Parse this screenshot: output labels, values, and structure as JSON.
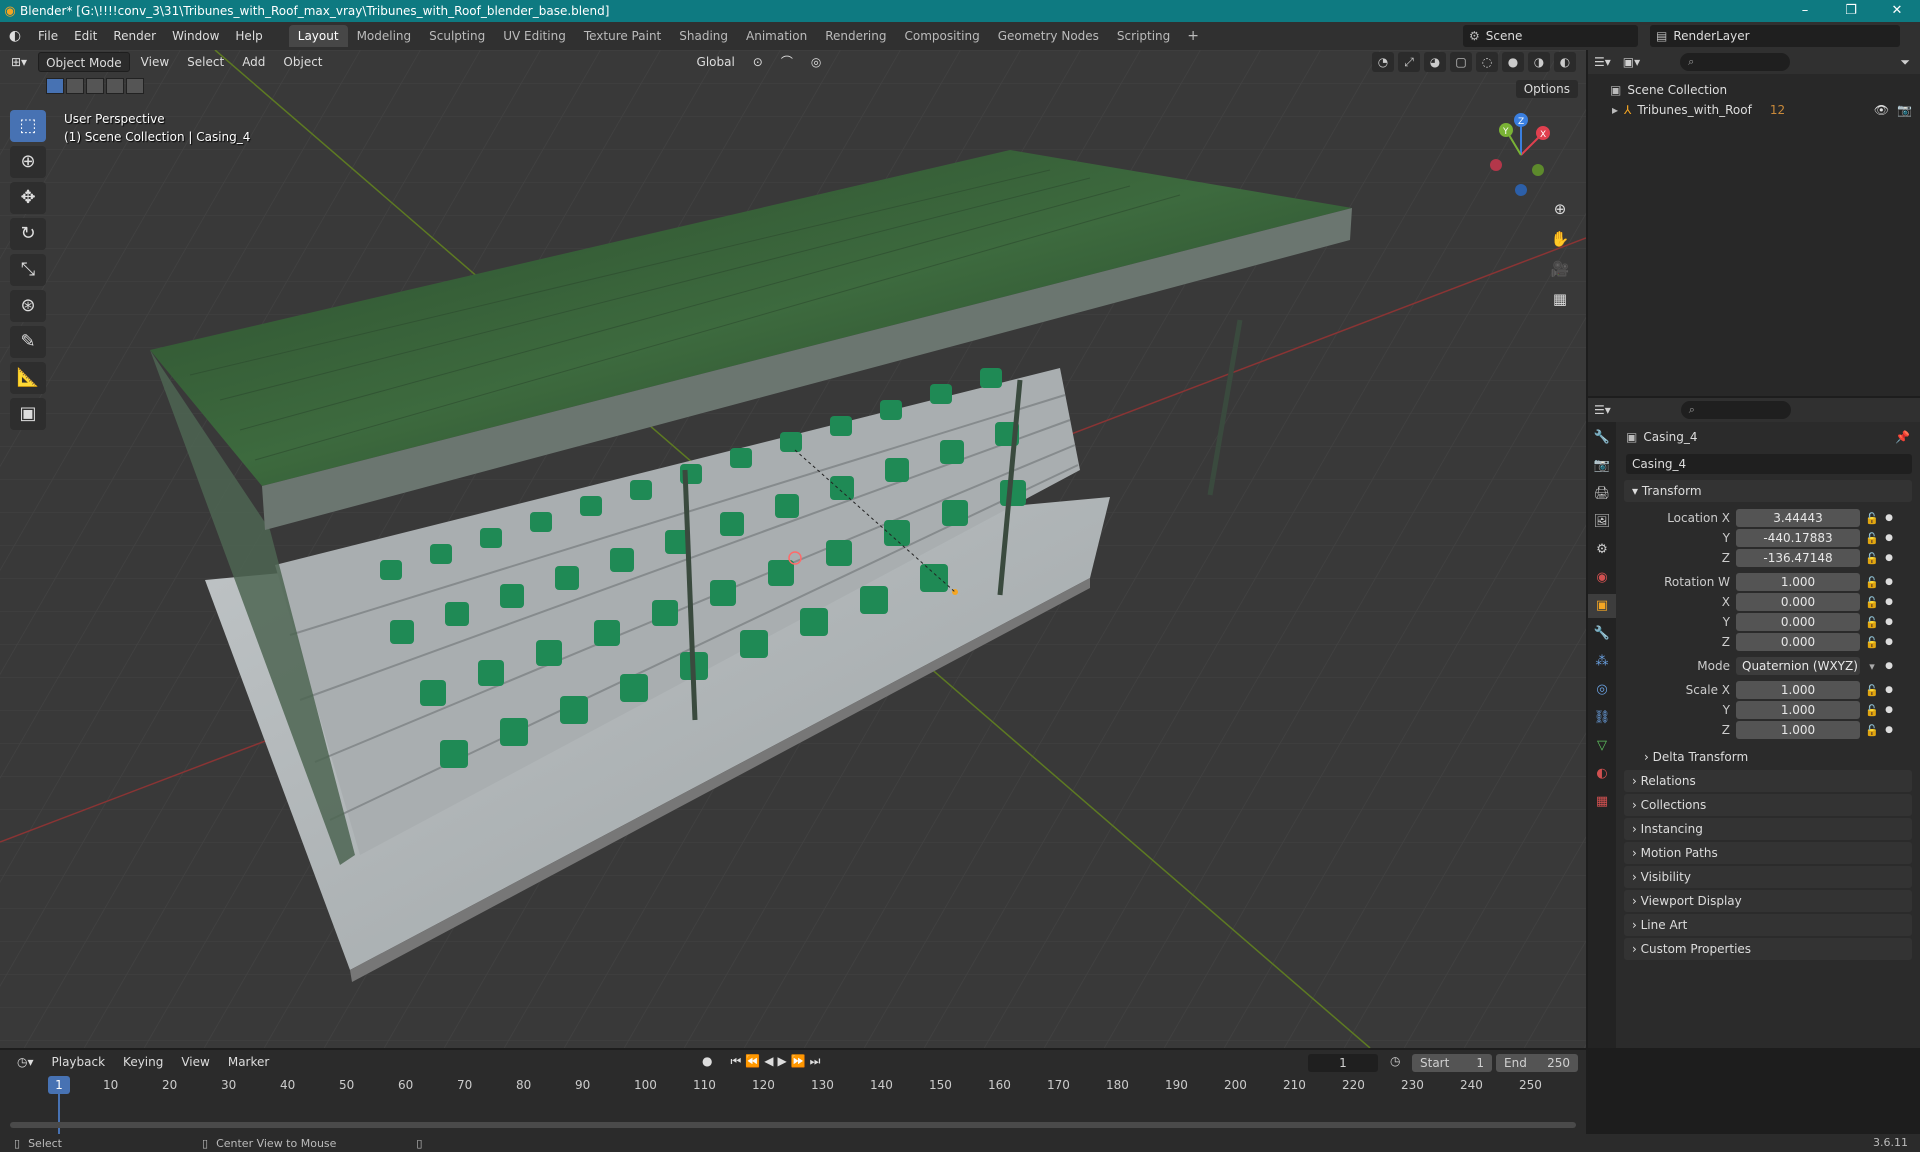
{
  "window": {
    "title": "Blender* [G:\\!!!!conv_3\\31\\Tribunes_with_Roof_max_vray\\Tribunes_with_Roof_blender_base.blend]",
    "controls": [
      "–",
      "❐",
      "✕"
    ]
  },
  "menu": [
    "File",
    "Edit",
    "Render",
    "Window",
    "Help"
  ],
  "workspaces": [
    {
      "label": "Layout",
      "active": true
    },
    {
      "label": "Modeling"
    },
    {
      "label": "Sculpting"
    },
    {
      "label": "UV Editing"
    },
    {
      "label": "Texture Paint"
    },
    {
      "label": "Shading"
    },
    {
      "label": "Animation"
    },
    {
      "label": "Rendering"
    },
    {
      "label": "Compositing"
    },
    {
      "label": "Geometry Nodes"
    },
    {
      "label": "Scripting"
    }
  ],
  "scene": "Scene",
  "render_layer": "RenderLayer",
  "viewport": {
    "mode": "Object Mode",
    "menus": [
      "View",
      "Select",
      "Add",
      "Object"
    ],
    "orientation": "Global",
    "options": "Options",
    "perspective": "User Perspective",
    "collection_path": "(1) Scene Collection | Casing_4",
    "gizmo": {
      "x": "X",
      "y": "Y",
      "z": "Z"
    }
  },
  "outliner": {
    "root": "Scene Collection",
    "items": [
      {
        "label": "Tribunes_with_Roof",
        "badge": "12"
      }
    ]
  },
  "properties": {
    "object": "Casing_4",
    "object_field": "Casing_4",
    "transform_label": "Transform",
    "location": {
      "label": "Location X",
      "x": "3.44443",
      "y": "-440.17883",
      "z": "-136.47148"
    },
    "rotation": {
      "label": "Rotation W",
      "w": "1.000",
      "x": "0.000",
      "y": "0.000",
      "z": "0.000"
    },
    "mode": {
      "label": "Mode",
      "value": "Quaternion (WXYZ)"
    },
    "scale": {
      "label": "Scale X",
      "x": "1.000",
      "y": "1.000",
      "z": "1.000"
    },
    "axis_labels": {
      "y": "Y",
      "z": "Z",
      "x": "X"
    },
    "delta": "Delta Transform",
    "panels": [
      "Relations",
      "Collections",
      "Instancing",
      "Motion Paths",
      "Visibility",
      "Viewport Display",
      "Line Art",
      "Custom Properties"
    ]
  },
  "timeline": {
    "menus": [
      "Playback",
      "Keying",
      "View",
      "Marker"
    ],
    "current_frame": "1",
    "start_label": "Start",
    "start": "1",
    "end_label": "End",
    "end": "250",
    "ticks": [
      "10",
      "20",
      "30",
      "40",
      "50",
      "60",
      "70",
      "80",
      "90",
      "100",
      "110",
      "120",
      "130",
      "140",
      "150",
      "160",
      "170",
      "180",
      "190",
      "200",
      "210",
      "220",
      "230",
      "240",
      "250"
    ],
    "frame_marker": "1"
  },
  "statusbar": {
    "select": "Select",
    "center": "Center View to Mouse",
    "version": "3.6.11"
  }
}
